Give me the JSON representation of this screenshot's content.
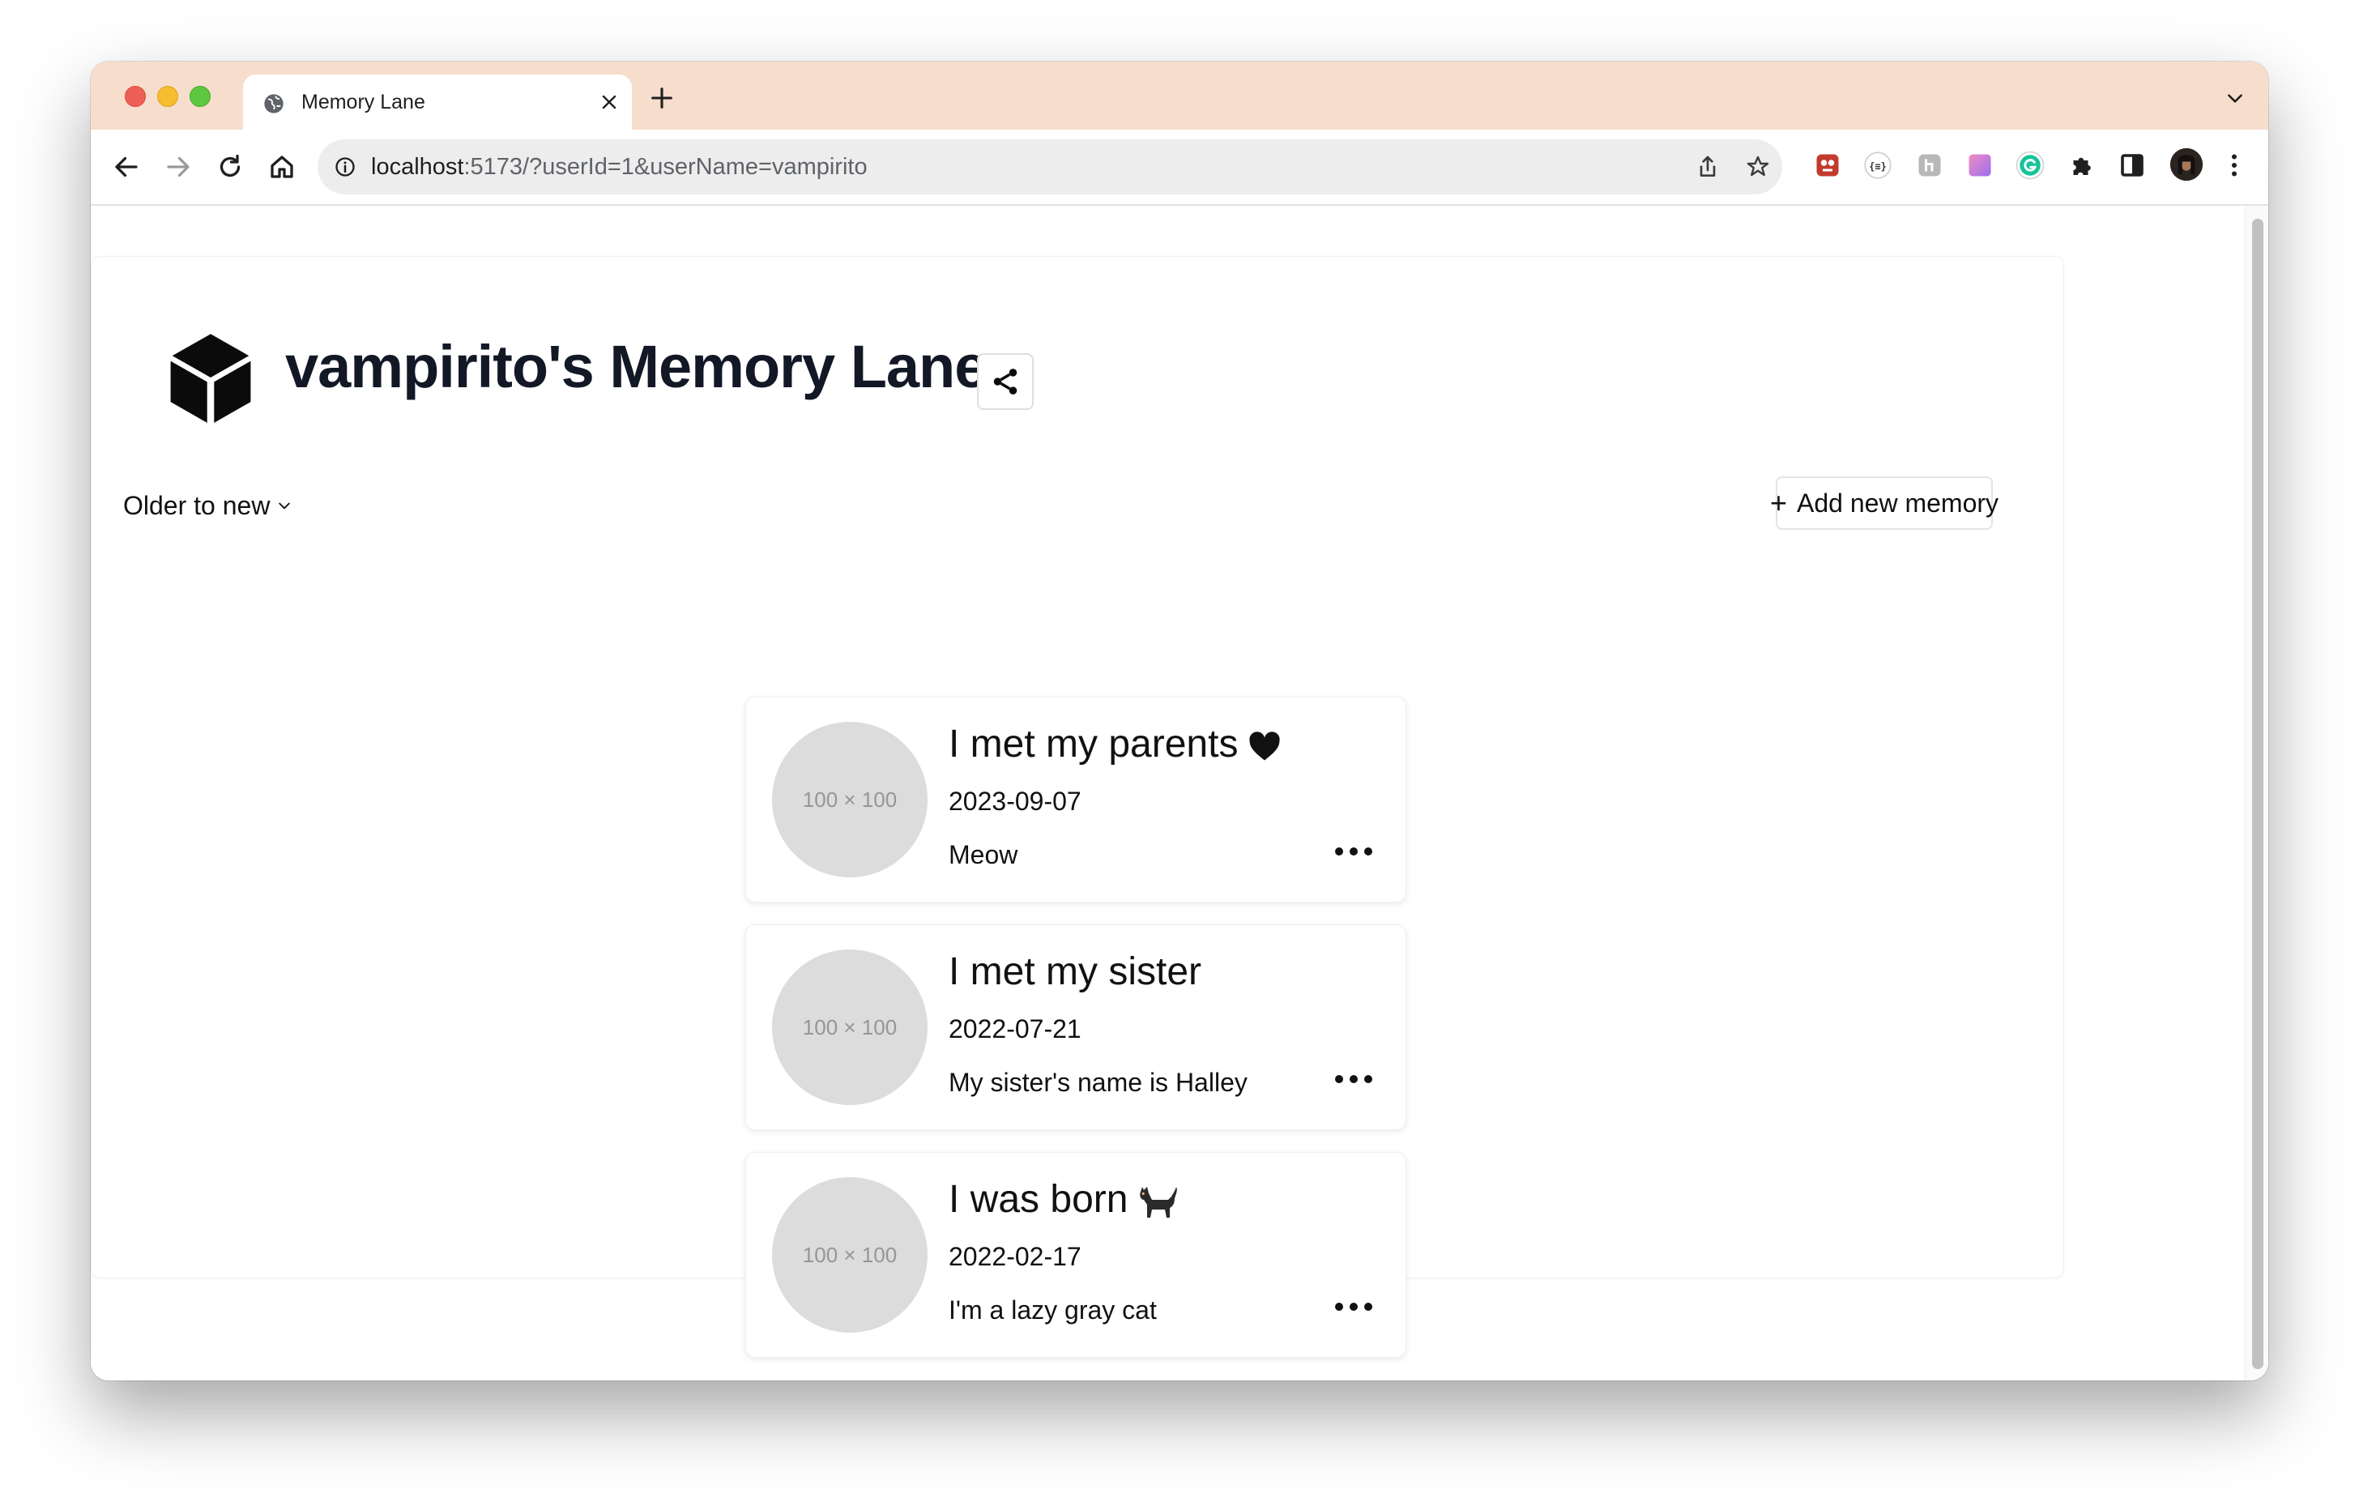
{
  "browser": {
    "tab_title": "Memory Lane",
    "url_host": "localhost",
    "url_rest": ":5173/?userId=1&userName=vampirito"
  },
  "page": {
    "title": "vampirito's Memory Lane",
    "sort_label": "Older to new",
    "add_button_label": "Add new memory"
  },
  "memories": [
    {
      "title": "I met my parents",
      "emoji": "heart-icon",
      "date": "2023-09-07",
      "description": "Meow",
      "thumbnail": "100 × 100"
    },
    {
      "title": "I met my sister",
      "emoji": "",
      "date": "2022-07-21",
      "description": "My sister's name is Halley",
      "thumbnail": "100 × 100"
    },
    {
      "title": "I was born",
      "emoji": "cat-icon",
      "date": "2022-02-17",
      "description": "I'm a lazy gray cat",
      "thumbnail": "100 × 100"
    }
  ],
  "colors": {
    "tab_strip": "#f7ddcc",
    "title_text": "#121826",
    "thumbnail_bg": "#dcdcdc"
  }
}
